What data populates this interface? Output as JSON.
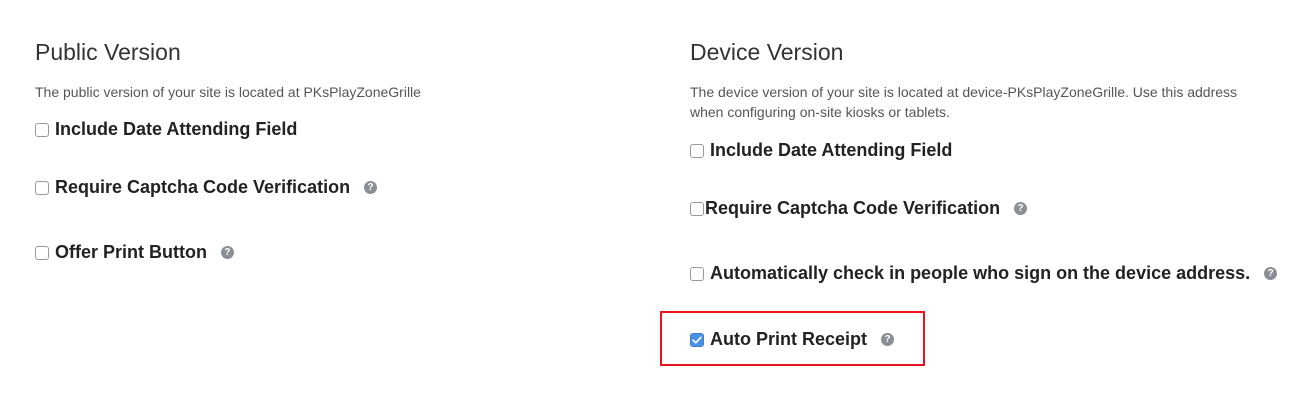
{
  "public": {
    "title": "Public Version",
    "description": "The public version of your site is located at PKsPlayZoneGrille",
    "options": [
      {
        "label": "Include Date Attending Field",
        "checked": false,
        "help": false
      },
      {
        "label": "Require Captcha Code Verification",
        "checked": false,
        "help": true
      },
      {
        "label": "Offer Print Button",
        "checked": false,
        "help": true
      }
    ]
  },
  "device": {
    "title": "Device Version",
    "description": "The device version of your site is located at device-PKsPlayZoneGrille. Use this address when configuring on-site kiosks or tablets.",
    "options": [
      {
        "label": "Include Date Attending Field",
        "checked": false,
        "help": false
      },
      {
        "label": "Require Captcha Code Verification",
        "checked": false,
        "help": true
      },
      {
        "label": "Automatically check in people who sign on the device address.",
        "checked": false,
        "help": true
      },
      {
        "label": "Auto Print Receipt",
        "checked": true,
        "help": true
      }
    ]
  },
  "help_glyph": "?",
  "colors": {
    "checkbox_checked": "#4a90e2",
    "highlight": "#e8131c",
    "help_icon": "#8a8f96"
  },
  "icons": {
    "help": "question-circle-icon",
    "check": "checkmark-icon"
  }
}
